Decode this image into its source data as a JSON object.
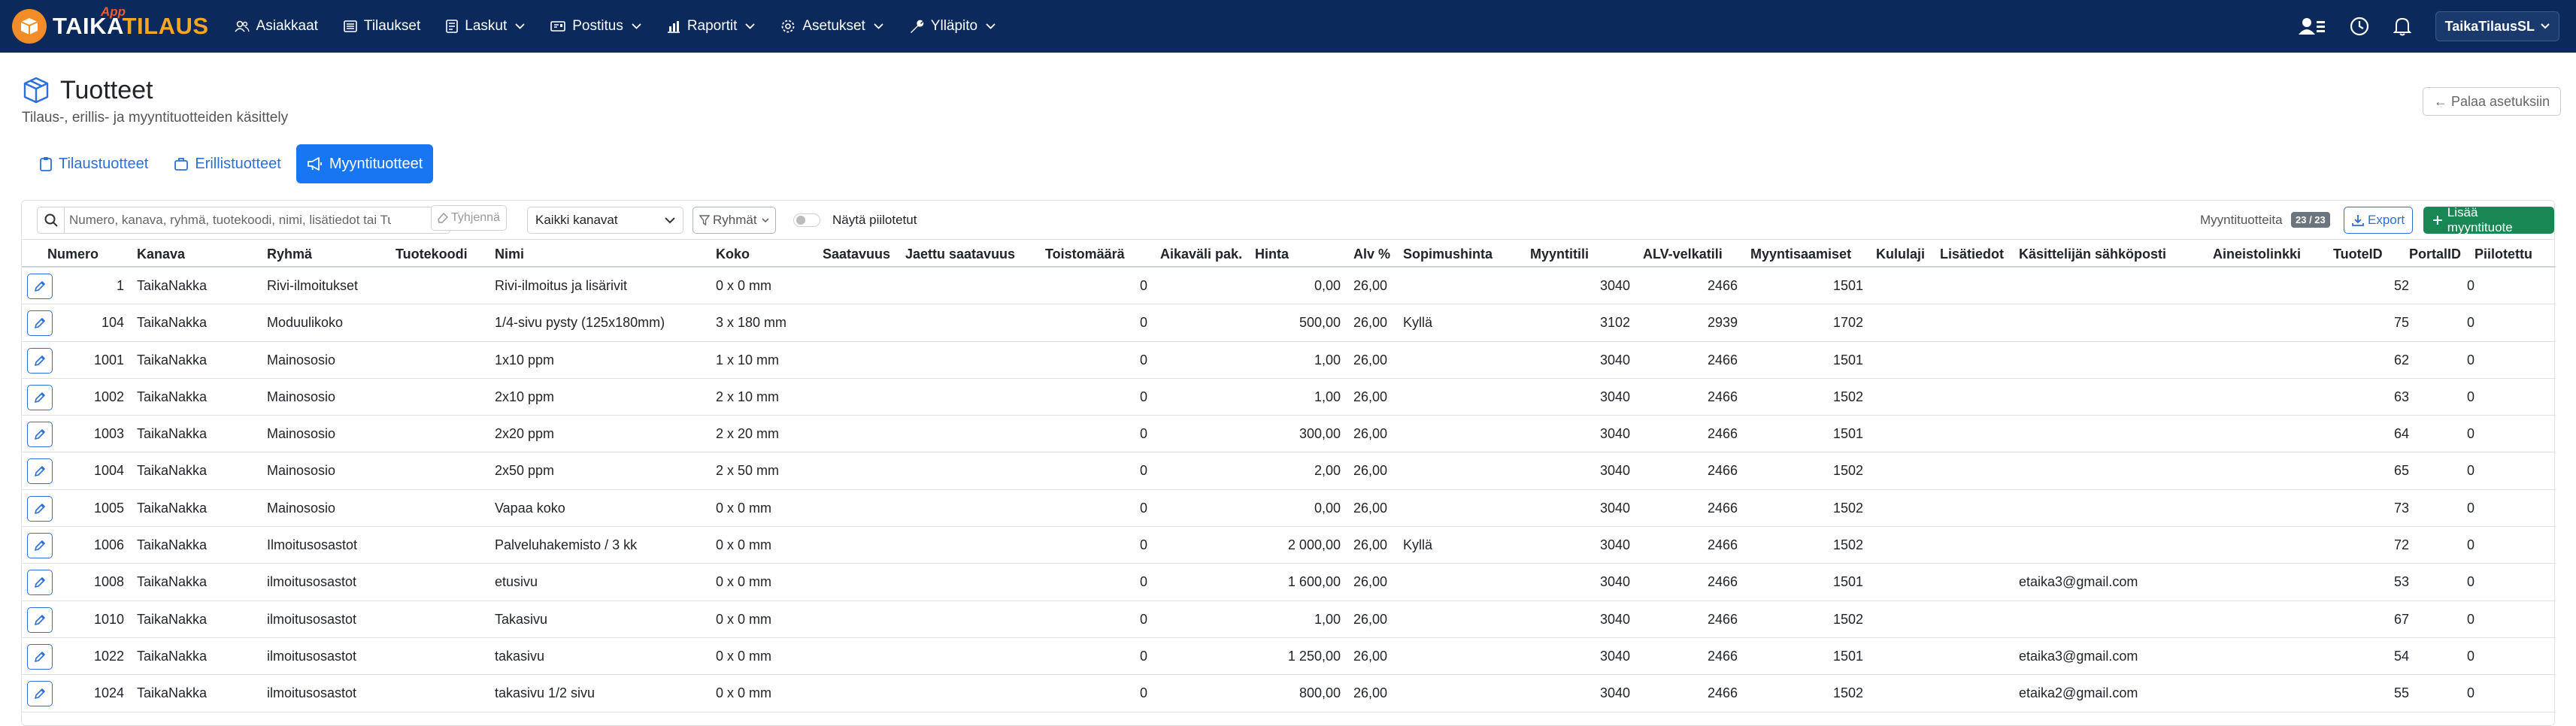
{
  "nav": {
    "logo_word1": "TAIKA",
    "logo_word2": "TILAUS",
    "logo_app": "App",
    "items": [
      {
        "label": "Asiakkaat",
        "icon": "users-icon",
        "dropdown": false
      },
      {
        "label": "Tilaukset",
        "icon": "list-icon",
        "dropdown": false
      },
      {
        "label": "Laskut",
        "icon": "invoice-icon",
        "dropdown": true
      },
      {
        "label": "Postitus",
        "icon": "mail-icon",
        "dropdown": true
      },
      {
        "label": "Raportit",
        "icon": "chart-icon",
        "dropdown": true
      },
      {
        "label": "Asetukset",
        "icon": "gear-icon",
        "dropdown": true
      },
      {
        "label": "Ylläpito",
        "icon": "wrench-icon",
        "dropdown": true
      }
    ],
    "user": "TaikaTilausSL"
  },
  "page": {
    "title": "Tuotteet",
    "subtitle": "Tilaus-, erillis- ja myyntituotteiden käsittely",
    "back_label": "← Palaa asetuksiin"
  },
  "tabs": [
    {
      "label": "Tilaustuotteet",
      "active": false
    },
    {
      "label": "Erillistuotteet",
      "active": false
    },
    {
      "label": "Myyntituotteet",
      "active": true
    }
  ],
  "toolbar": {
    "search_placeholder": "Numero, kanava, ryhmä, tuotekoodi, nimi, lisätiedot tai Tuotel",
    "clear_label": "Tyhjennä",
    "channel_value": "Kaikki kanavat",
    "groups_label": "Ryhmät",
    "show_hidden_label": "Näytä piilotetut",
    "count_label": "Myyntituotteita",
    "count_badge": "23 / 23",
    "export_label": "Export",
    "add_label": "Lisää myyntituote"
  },
  "table": {
    "columns": [
      "Numero",
      "Kanava",
      "Ryhmä",
      "Tuotekoodi",
      "Nimi",
      "Koko",
      "Saatavuus",
      "Jaettu saatavuus",
      "Toistomäärä",
      "Aikaväli pak.",
      "Hinta",
      "Alv %",
      "Sopimushinta",
      "Myyntitili",
      "ALV-velkatili",
      "Myyntisaamiset",
      "Kululaji",
      "Lisätiedot",
      "Käsittelijän sähköposti",
      "Aineistolinkki",
      "TuoteID",
      "PortalID",
      "Piilotettu"
    ],
    "rows": [
      {
        "numero": "1",
        "kanava": "TaikaNakka",
        "ryhma": "Rivi-ilmoitukset",
        "nimi": "Rivi-ilmoitus ja lisärivit",
        "koko": "0 x 0 mm",
        "toisto": "0",
        "hinta": "0,00",
        "alv": "26,00",
        "sopimus": "",
        "myyntitili": "3040",
        "alvtili": "2466",
        "saamiset": "1501",
        "email": "",
        "tuoteid": "52",
        "portalid": "0"
      },
      {
        "numero": "104",
        "kanava": "TaikaNakka",
        "ryhma": "Moduulikoko",
        "nimi": "1/4-sivu pysty (125x180mm)",
        "koko": "3 x 180 mm",
        "toisto": "0",
        "hinta": "500,00",
        "alv": "26,00",
        "sopimus": "Kyllä",
        "myyntitili": "3102",
        "alvtili": "2939",
        "saamiset": "1702",
        "email": "",
        "tuoteid": "75",
        "portalid": "0"
      },
      {
        "numero": "1001",
        "kanava": "TaikaNakka",
        "ryhma": "Mainososio",
        "nimi": "1x10 ppm",
        "koko": "1 x 10 mm",
        "toisto": "0",
        "hinta": "1,00",
        "alv": "26,00",
        "sopimus": "",
        "myyntitili": "3040",
        "alvtili": "2466",
        "saamiset": "1501",
        "email": "",
        "tuoteid": "62",
        "portalid": "0"
      },
      {
        "numero": "1002",
        "kanava": "TaikaNakka",
        "ryhma": "Mainososio",
        "nimi": "2x10 ppm",
        "koko": "2 x 10 mm",
        "toisto": "0",
        "hinta": "1,00",
        "alv": "26,00",
        "sopimus": "",
        "myyntitili": "3040",
        "alvtili": "2466",
        "saamiset": "1502",
        "email": "",
        "tuoteid": "63",
        "portalid": "0"
      },
      {
        "numero": "1003",
        "kanava": "TaikaNakka",
        "ryhma": "Mainososio",
        "nimi": "2x20 ppm",
        "koko": "2 x 20 mm",
        "toisto": "0",
        "hinta": "300,00",
        "alv": "26,00",
        "sopimus": "",
        "myyntitili": "3040",
        "alvtili": "2466",
        "saamiset": "1501",
        "email": "",
        "tuoteid": "64",
        "portalid": "0"
      },
      {
        "numero": "1004",
        "kanava": "TaikaNakka",
        "ryhma": "Mainososio",
        "nimi": "2x50 ppm",
        "koko": "2 x 50 mm",
        "toisto": "0",
        "hinta": "2,00",
        "alv": "26,00",
        "sopimus": "",
        "myyntitili": "3040",
        "alvtili": "2466",
        "saamiset": "1502",
        "email": "",
        "tuoteid": "65",
        "portalid": "0"
      },
      {
        "numero": "1005",
        "kanava": "TaikaNakka",
        "ryhma": "Mainososio",
        "nimi": "Vapaa koko",
        "koko": "0 x 0 mm",
        "toisto": "0",
        "hinta": "0,00",
        "alv": "26,00",
        "sopimus": "",
        "myyntitili": "3040",
        "alvtili": "2466",
        "saamiset": "1502",
        "email": "",
        "tuoteid": "73",
        "portalid": "0"
      },
      {
        "numero": "1006",
        "kanava": "TaikaNakka",
        "ryhma": "Ilmoitusosastot",
        "nimi": "Palveluhakemisto / 3 kk",
        "koko": "0 x 0 mm",
        "toisto": "0",
        "hinta": "2 000,00",
        "alv": "26,00",
        "sopimus": "Kyllä",
        "myyntitili": "3040",
        "alvtili": "2466",
        "saamiset": "1502",
        "email": "",
        "tuoteid": "72",
        "portalid": "0"
      },
      {
        "numero": "1008",
        "kanava": "TaikaNakka",
        "ryhma": "ilmoitusosastot",
        "nimi": "etusivu",
        "koko": "0 x 0 mm",
        "toisto": "0",
        "hinta": "1 600,00",
        "alv": "26,00",
        "sopimus": "",
        "myyntitili": "3040",
        "alvtili": "2466",
        "saamiset": "1501",
        "email": "etaika3@gmail.com",
        "tuoteid": "53",
        "portalid": "0"
      },
      {
        "numero": "1010",
        "kanava": "TaikaNakka",
        "ryhma": "ilmoitusosastot",
        "nimi": "Takasivu",
        "koko": "0 x 0 mm",
        "toisto": "0",
        "hinta": "1,00",
        "alv": "26,00",
        "sopimus": "",
        "myyntitili": "3040",
        "alvtili": "2466",
        "saamiset": "1502",
        "email": "",
        "tuoteid": "67",
        "portalid": "0"
      },
      {
        "numero": "1022",
        "kanava": "TaikaNakka",
        "ryhma": "ilmoitusosastot",
        "nimi": "takasivu",
        "koko": "0 x 0 mm",
        "toisto": "0",
        "hinta": "1 250,00",
        "alv": "26,00",
        "sopimus": "",
        "myyntitili": "3040",
        "alvtili": "2466",
        "saamiset": "1501",
        "email": "etaika3@gmail.com",
        "tuoteid": "54",
        "portalid": "0"
      },
      {
        "numero": "1024",
        "kanava": "TaikaNakka",
        "ryhma": "ilmoitusosastot",
        "nimi": "takasivu 1/2 sivu",
        "koko": "0 x 0 mm",
        "toisto": "0",
        "hinta": "800,00",
        "alv": "26,00",
        "sopimus": "",
        "myyntitili": "3040",
        "alvtili": "2466",
        "saamiset": "1502",
        "email": "etaika2@gmail.com",
        "tuoteid": "55",
        "portalid": "0"
      }
    ]
  }
}
